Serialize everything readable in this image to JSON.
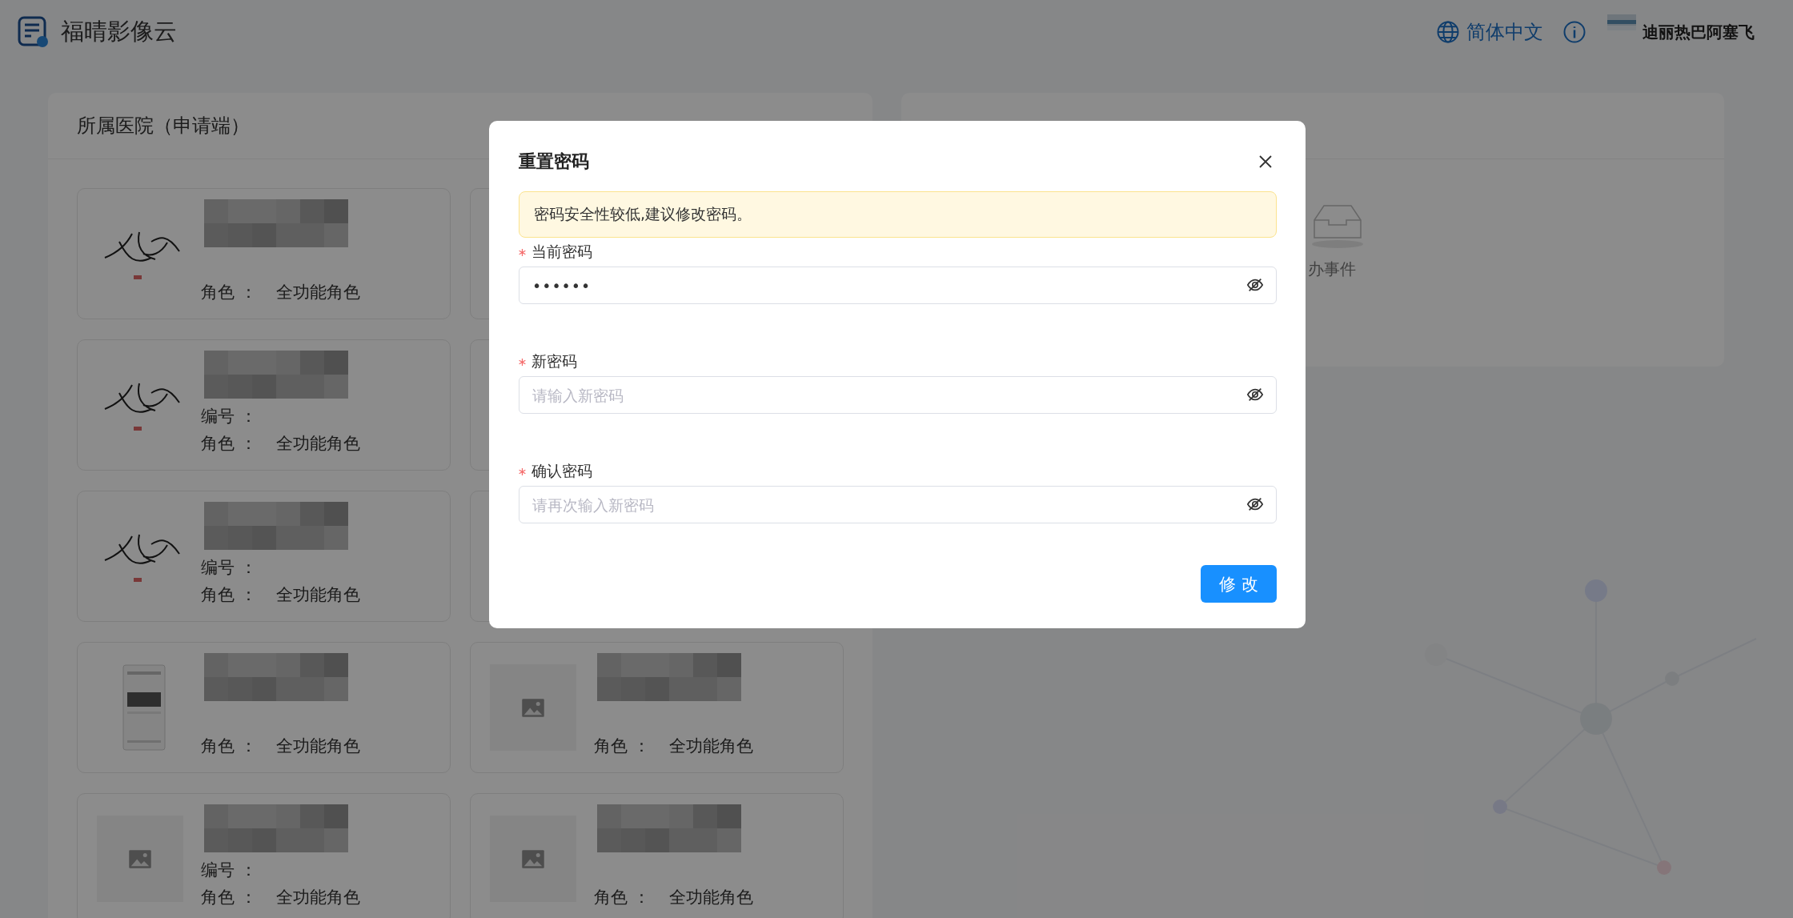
{
  "header": {
    "app_name": "福晴影像云",
    "language": "简体中文",
    "user_name": "迪丽热巴阿塞飞"
  },
  "hospital_panel": {
    "title": "所属医院（申请端）",
    "cards": [
      {
        "kind": "signature",
        "role_label": "角色 ：",
        "role": "全功能角色"
      },
      {
        "kind": "covered"
      },
      {
        "kind": "signature",
        "number_label": "编号 ：",
        "role_label": "角色 ：",
        "role": "全功能角色"
      },
      {
        "kind": "covered"
      },
      {
        "kind": "signature",
        "number_label": "编号 ：",
        "role_label": "角色 ：",
        "role": "全功能角色"
      },
      {
        "kind": "covered"
      },
      {
        "kind": "screenshot",
        "role_label": "角色 ：",
        "role": "全功能角色"
      },
      {
        "kind": "placeholder",
        "role_label": "角色 ：",
        "role": "全功能角色"
      },
      {
        "kind": "placeholder",
        "number_label": "编号 ：",
        "role_label": "角色 ：",
        "role": "全功能角色"
      },
      {
        "kind": "placeholder",
        "role_label": "角色 ：",
        "role": "全功能角色"
      }
    ]
  },
  "todo_panel": {
    "empty_text": "办事件"
  },
  "dialog": {
    "title": "重置密码",
    "warning": "密码安全性较低,建议修改密码。",
    "fields": [
      {
        "label": "当前密码",
        "required": true,
        "value": "••••••"
      },
      {
        "label": "新密码",
        "required": true,
        "placeholder": "请输入新密码"
      },
      {
        "label": "确认密码",
        "required": true,
        "placeholder": "请再次输入新密码"
      }
    ],
    "submit": "修 改"
  }
}
